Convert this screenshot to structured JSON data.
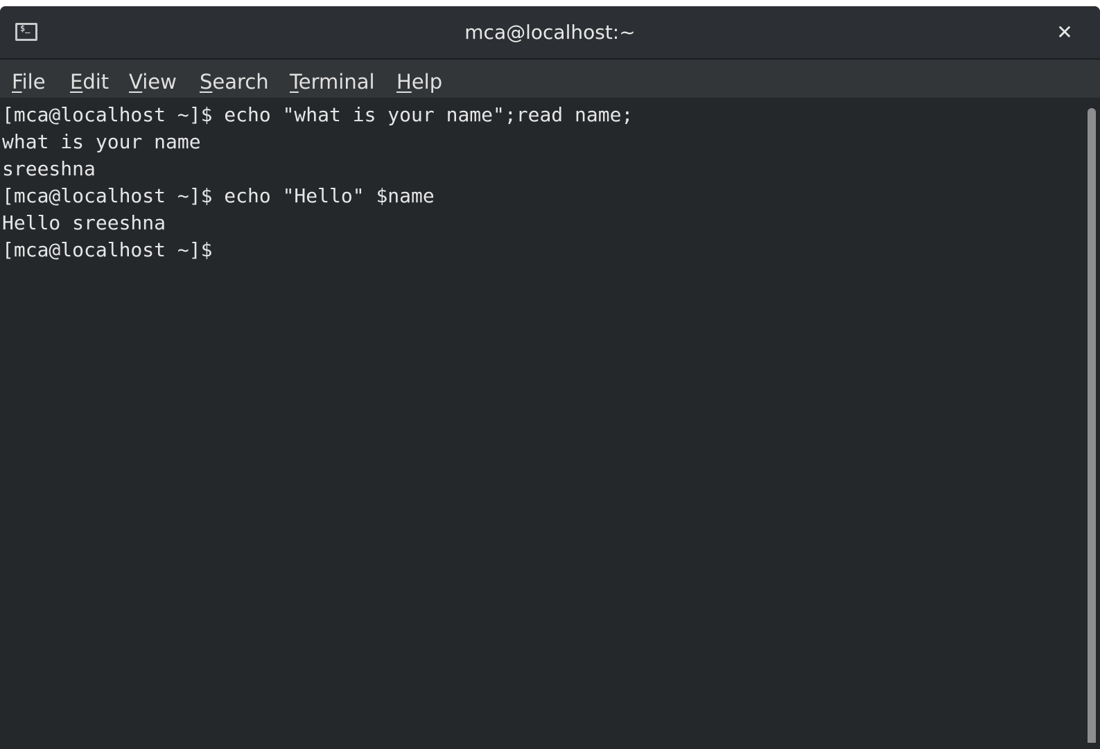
{
  "window": {
    "title": "mca@localhost:~",
    "close_glyph": "✕",
    "icon_prompt": "$_"
  },
  "menu": {
    "items": [
      {
        "mnemonic": "F",
        "rest": "ile"
      },
      {
        "mnemonic": "E",
        "rest": "dit"
      },
      {
        "mnemonic": "V",
        "rest": "iew"
      },
      {
        "mnemonic": "S",
        "rest": "earch"
      },
      {
        "mnemonic": "T",
        "rest": "erminal"
      },
      {
        "mnemonic": "H",
        "rest": "elp"
      }
    ]
  },
  "terminal": {
    "lines": [
      "[mca@localhost ~]$ echo \"what is your name\";read name;",
      "what is your name",
      "sreeshna",
      "[mca@localhost ~]$ echo \"Hello\" $name",
      "Hello sreeshna",
      "[mca@localhost ~]$ "
    ]
  },
  "icons": {
    "window_icon": "terminal-icon",
    "close": "close-icon"
  },
  "colors": {
    "background": "#25282b",
    "titlebar": "#2c2f33",
    "menubar": "#333639",
    "text": "#e6e6e6",
    "scrollbar_thumb": "#8c8e90"
  }
}
